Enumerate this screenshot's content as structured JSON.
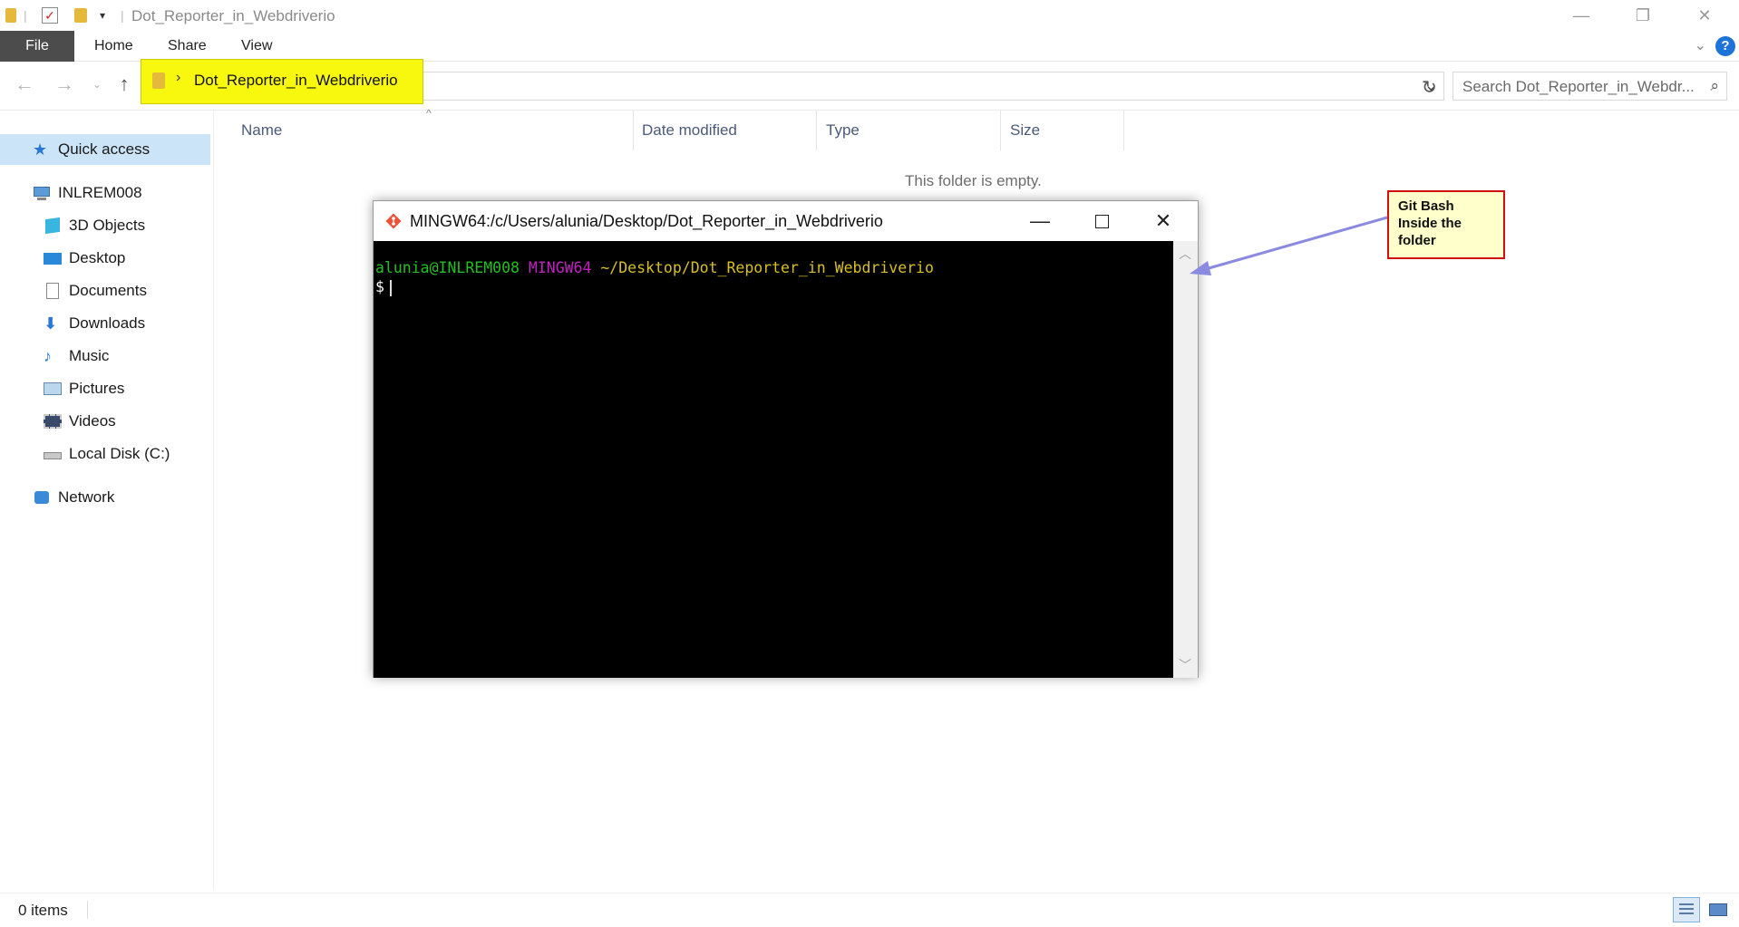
{
  "window": {
    "title": "Dot_Reporter_in_Webdriverio",
    "minimize": "—",
    "restore": "❐",
    "close": "✕"
  },
  "ribbon": {
    "tabs": [
      "File",
      "Home",
      "Share",
      "View"
    ]
  },
  "address": {
    "path": "Dot_Reporter_in_Webdriverio",
    "highlight_color": "#f8f80f"
  },
  "search": {
    "placeholder": "Search Dot_Reporter_in_Webdr..."
  },
  "sidebar": {
    "items": [
      {
        "label": "Quick access",
        "icon": "star-icon",
        "selected": true
      },
      {
        "label": "INLREM008",
        "icon": "computer-icon"
      },
      {
        "label": "3D Objects",
        "icon": "cube-icon"
      },
      {
        "label": "Desktop",
        "icon": "desktop-icon"
      },
      {
        "label": "Documents",
        "icon": "document-icon"
      },
      {
        "label": "Downloads",
        "icon": "download-icon"
      },
      {
        "label": "Music",
        "icon": "music-icon"
      },
      {
        "label": "Pictures",
        "icon": "pictures-icon"
      },
      {
        "label": "Videos",
        "icon": "video-icon"
      },
      {
        "label": "Local Disk (C:)",
        "icon": "disk-icon"
      },
      {
        "label": "Network",
        "icon": "network-icon"
      }
    ]
  },
  "columns": [
    "Name",
    "Date modified",
    "Type",
    "Size"
  ],
  "content": {
    "empty_message": "This folder is empty."
  },
  "bash": {
    "title": "MINGW64:/c/Users/alunia/Desktop/Dot_Reporter_in_Webdriverio",
    "prompt_user": "alunia@INLREM008",
    "prompt_host": "MINGW64",
    "prompt_path": "~/Desktop/Dot_Reporter_in_Webdriverio",
    "prompt_symbol": "$"
  },
  "callout": {
    "text": "Git Bash Inside the folder",
    "border_color": "#d01010",
    "fill_color": "#ffffcc"
  },
  "status": {
    "item_count": "0 items"
  }
}
